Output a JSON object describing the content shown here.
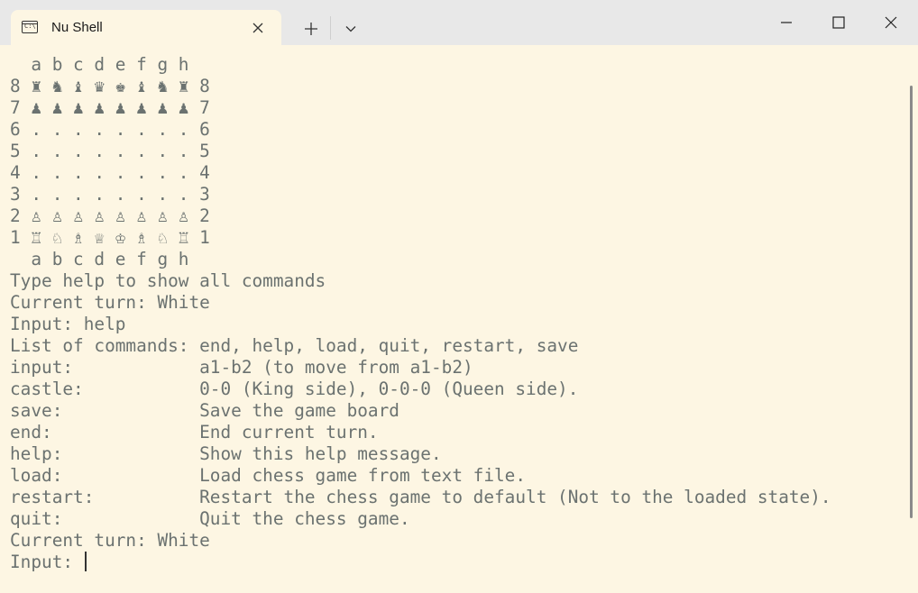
{
  "window": {
    "tab_title": "Nu Shell",
    "icon_text": "C:\\",
    "buttons": [
      "minimize",
      "maximize",
      "close"
    ]
  },
  "terminal": {
    "lines": [
      "  a b c d e f g h",
      "8 ♜ ♞ ♝ ♛ ♚ ♝ ♞ ♜ 8",
      "7 ♟ ♟ ♟ ♟ ♟ ♟ ♟ ♟ 7",
      "6 . . . . . . . . 6",
      "5 . . . . . . . . 5",
      "4 . . . . . . . . 4",
      "3 . . . . . . . . 3",
      "2 ♙ ♙ ♙ ♙ ♙ ♙ ♙ ♙ 2",
      "1 ♖ ♘ ♗ ♕ ♔ ♗ ♘ ♖ 1",
      "  a b c d e f g h",
      "Type help to show all commands",
      "Current turn: White",
      "Input: help",
      "List of commands: end, help, load, quit, restart, save",
      "input:            a1-b2 (to move from a1-b2)",
      "castle:           0-0 (King side), 0-0-0 (Queen side).",
      "save:             Save the game board",
      "end:              End current turn.",
      "help:             Show this help message.",
      "load:             Load chess game from text file.",
      "restart:          Restart the chess game to default (Not to the loaded state).",
      "quit:             Quit the chess game.",
      "Current turn: White"
    ],
    "prompt": "Input: "
  },
  "colors": {
    "background": "#fdf6e3",
    "text": "#6b7270",
    "titlebar": "#e8e8e8"
  }
}
